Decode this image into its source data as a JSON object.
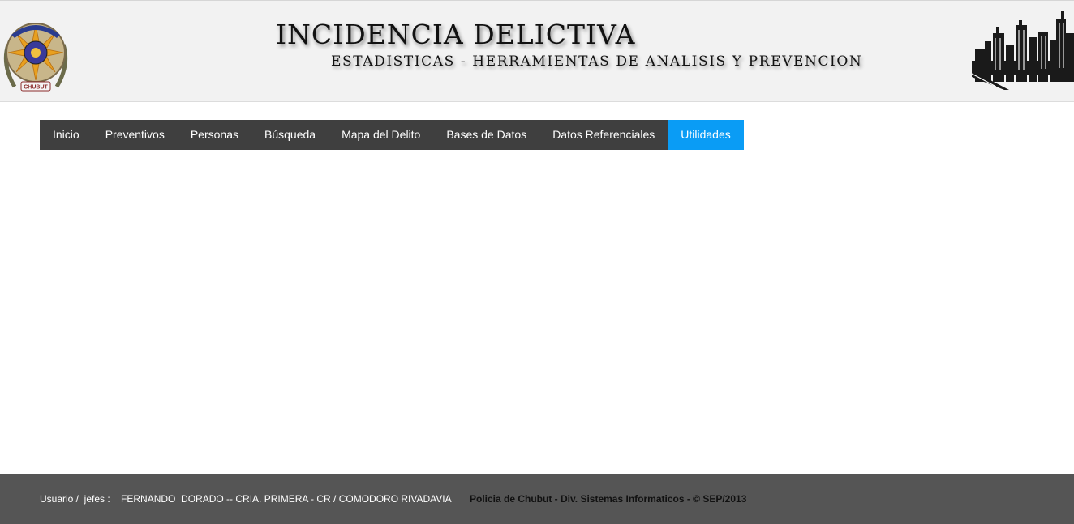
{
  "header": {
    "title": "INCIDENCIA DELICTIVA",
    "subtitle": "ESTADISTICAS - HERRAMIENTAS DE ANALISIS Y PREVENCION",
    "logo_text": "CHUBUT",
    "logo_icon": "police-badge-icon",
    "skyline_icon": "city-skyline-icon"
  },
  "nav": {
    "items": [
      {
        "label": "Inicio"
      },
      {
        "label": "Preventivos"
      },
      {
        "label": "Personas"
      },
      {
        "label": "Búsqueda"
      },
      {
        "label": "Mapa del Delito"
      },
      {
        "label": "Bases de Datos"
      },
      {
        "label": "Datos Referenciales"
      },
      {
        "label": "Utilidades"
      }
    ],
    "active": "Utilidades",
    "active_color": "#0a9cf5",
    "bar_color": "#3f3f3f"
  },
  "footer": {
    "user_text": "Usuario /  jefes :    FERNANDO  DORADO -- CRIA. PRIMERA - CR / COMODORO RIVADAVIA",
    "copyright": "Policia de Chubut - Div. Sistemas Informaticos - © SEP/2013"
  }
}
